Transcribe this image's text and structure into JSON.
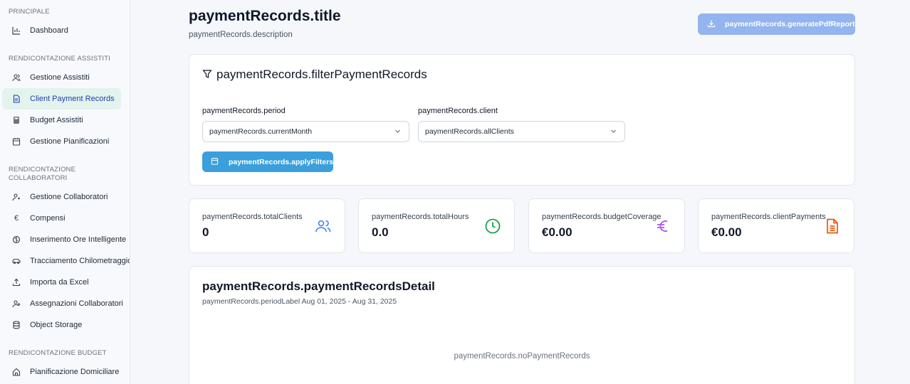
{
  "sidebar": {
    "sections": [
      {
        "title": "PRINCIPALE",
        "items": [
          {
            "label": "Dashboard",
            "icon": "bar-chart-icon"
          }
        ]
      },
      {
        "title": "RENDICONTAZIONE ASSISTITI",
        "items": [
          {
            "label": "Gestione Assistiti",
            "icon": "users-icon"
          },
          {
            "label": "Client Payment Records",
            "icon": "document-icon",
            "active": true
          },
          {
            "label": "Budget Assistiti",
            "icon": "calculator-icon"
          },
          {
            "label": "Gestione Pianificazioni",
            "icon": "calendar-icon"
          }
        ]
      },
      {
        "title_line1": "RENDICONTAZIONE",
        "title_line2": "COLLABORATORI",
        "items": [
          {
            "label": "Gestione Collaboratori",
            "icon": "user-cog-icon"
          },
          {
            "label": "Compensi",
            "icon": "euro-icon"
          },
          {
            "label": "Inserimento Ore Intelligente",
            "icon": "brain-icon"
          },
          {
            "label": "Tracciamento Chilometraggio",
            "icon": "car-icon"
          },
          {
            "label": "Importa da Excel",
            "icon": "upload-icon"
          },
          {
            "label": "Assegnazioni Collaboratori",
            "icon": "user-plus-icon"
          },
          {
            "label": "Object Storage",
            "icon": "database-icon"
          }
        ]
      },
      {
        "title": "RENDICONTAZIONE BUDGET",
        "items": [
          {
            "label": "Pianificazione Domiciliare",
            "icon": "home-icon"
          }
        ]
      }
    ]
  },
  "header": {
    "title": "paymentRecords.title",
    "description": "paymentRecords.description",
    "pdf_button": "paymentRecords.generatePdfReport"
  },
  "filters": {
    "title": "paymentRecords.filterPaymentRecords",
    "period_label": "paymentRecords.period",
    "period_value": "paymentRecords.currentMonth",
    "client_label": "paymentRecords.client",
    "client_value": "paymentRecords.allClients",
    "apply_button": "paymentRecords.applyFilters"
  },
  "stats": [
    {
      "label": "paymentRecords.totalClients",
      "value": "0",
      "icon": "users-icon",
      "color": "#3b82f6"
    },
    {
      "label": "paymentRecords.totalHours",
      "value": "0.0",
      "icon": "clock-icon",
      "color": "#16a34a"
    },
    {
      "label": "paymentRecords.budgetCoverage",
      "value": "€0.00",
      "icon": "euro-icon",
      "color": "#a855f7"
    },
    {
      "label": "paymentRecords.clientPayments",
      "value": "€0.00",
      "icon": "file-text-icon",
      "color": "#ea580c"
    }
  ],
  "detail": {
    "title": "paymentRecords.paymentRecordsDetail",
    "period_label": "paymentRecords.periodLabel Aug 01, 2025 - Aug 31, 2025",
    "empty_message": "paymentRecords.noPaymentRecords"
  }
}
